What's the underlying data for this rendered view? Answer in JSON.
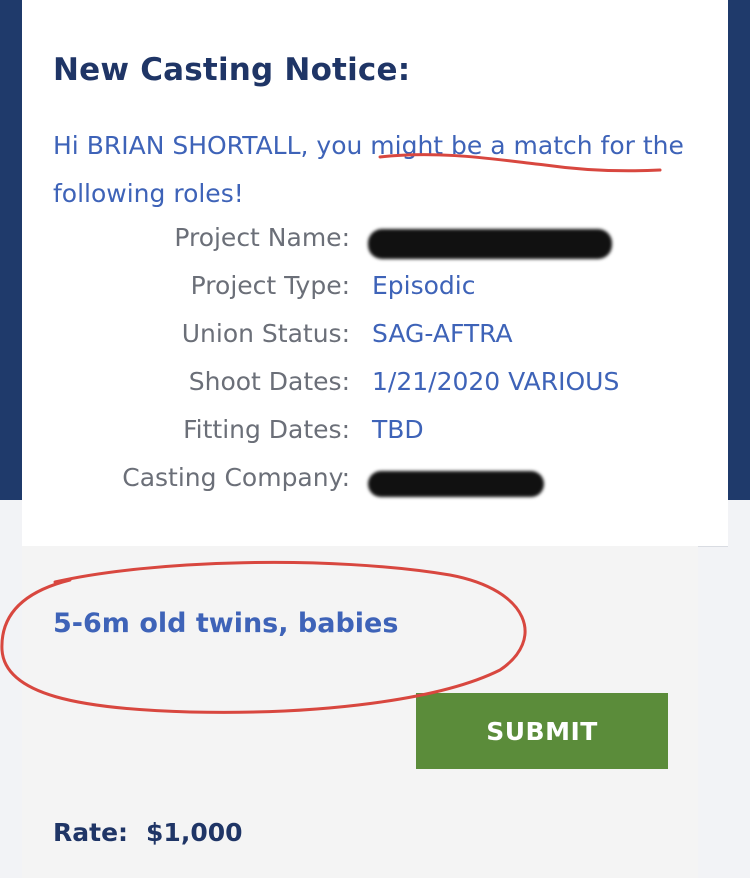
{
  "notice": {
    "title": "New Casting Notice:",
    "intro": "Hi BRIAN SHORTALL, you might be a match for the following roles!"
  },
  "details": [
    {
      "label": "Project Name:",
      "value": "",
      "redacted": true
    },
    {
      "label": "Project Type:",
      "value": "Episodic"
    },
    {
      "label": "Union Status:",
      "value": "SAG-AFTRA"
    },
    {
      "label": "Shoot Dates:",
      "value": "1/21/2020 VARIOUS"
    },
    {
      "label": "Fitting Dates:",
      "value": "TBD"
    },
    {
      "label": "Casting Company:",
      "value": "",
      "redacted": true
    }
  ],
  "role": {
    "name": "5-6m old twins, babies",
    "submit_label": "SUBMIT",
    "rate_label": "Rate:",
    "rate_value": "$1,000"
  },
  "colors": {
    "navy_background": "#1f3a6b",
    "title_navy": "#1f3566",
    "link_blue": "#3e63b8",
    "label_gray": "#6b6f78",
    "submit_green": "#5b8c3a",
    "annotation_red": "#d8473f"
  }
}
